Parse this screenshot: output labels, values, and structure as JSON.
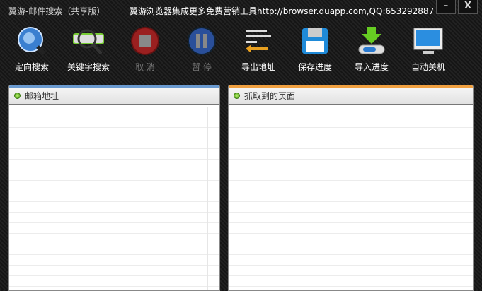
{
  "window": {
    "title": "翼游-邮件搜索（共享版）",
    "promo": "翼游浏览器集成更多免费营销工具http://browser.duapp.com,QQ:653292887",
    "minimize": "–",
    "close": "X"
  },
  "toolbar": [
    {
      "label": "定向搜索",
      "icon": "globe-search-icon",
      "enabled": true
    },
    {
      "label": "关键字搜索",
      "icon": "magnifier-icon",
      "enabled": true
    },
    {
      "label": "取 消",
      "icon": "stop-icon",
      "enabled": false
    },
    {
      "label": "暂 停",
      "icon": "pause-icon",
      "enabled": false
    },
    {
      "label": "导出地址",
      "icon": "export-list-icon",
      "enabled": true
    },
    {
      "label": "保存进度",
      "icon": "floppy-disk-icon",
      "enabled": true
    },
    {
      "label": "导入进度",
      "icon": "import-download-icon",
      "enabled": true
    },
    {
      "label": "自动关机",
      "icon": "monitor-icon",
      "enabled": true
    }
  ],
  "panels": {
    "left": {
      "title": "邮箱地址",
      "accent": "#6a9ad0"
    },
    "right": {
      "title": "抓取到的页面",
      "accent": "#f0a040"
    }
  }
}
